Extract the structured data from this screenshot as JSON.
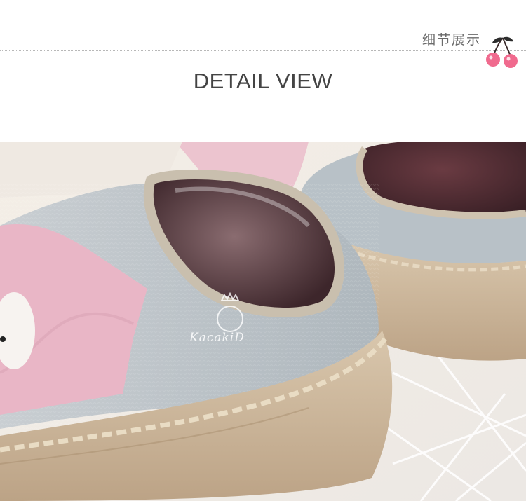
{
  "header": {
    "cn_label": "细节展示",
    "title": "DETAIL VIEW"
  },
  "photo": {
    "subject": "sock-shoe-detail",
    "watermark_text": "KacakiD",
    "colors": {
      "pink": "#e8b4c4",
      "grey_knit": "#b9c2c8",
      "sole": "#cdb89c",
      "insole": "#5a3c40"
    }
  }
}
